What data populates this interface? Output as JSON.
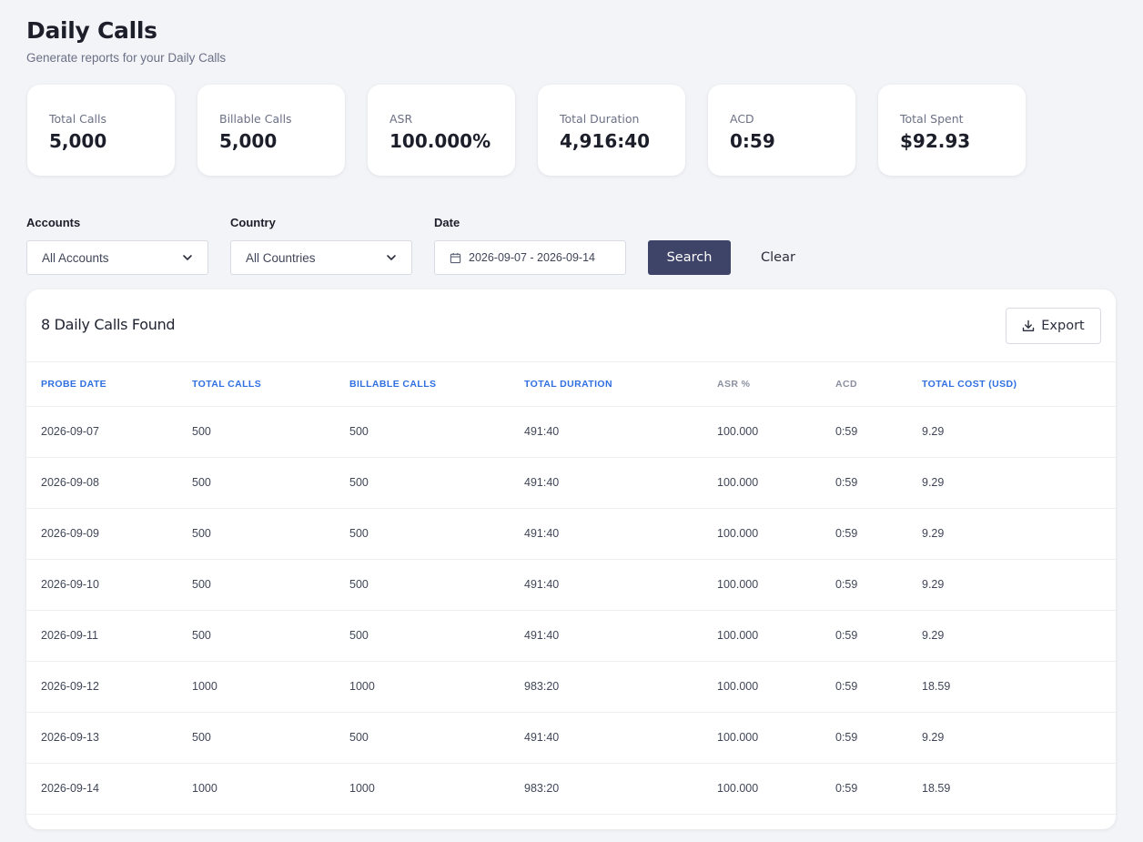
{
  "header": {
    "title": "Daily Calls",
    "subtitle": "Generate reports for your Daily Calls"
  },
  "stats": [
    {
      "label": "Total Calls",
      "value": "5,000"
    },
    {
      "label": "Billable Calls",
      "value": "5,000"
    },
    {
      "label": "ASR",
      "value": "100.000%"
    },
    {
      "label": "Total Duration",
      "value": "4,916:40"
    },
    {
      "label": "ACD",
      "value": "0:59"
    },
    {
      "label": "Total Spent",
      "value": "$92.93"
    }
  ],
  "filters": {
    "accounts_label": "Accounts",
    "accounts_value": "All Accounts",
    "country_label": "Country",
    "country_value": "All Countries",
    "date_label": "Date",
    "date_value": "2026-09-07 - 2026-09-14",
    "search_label": "Search",
    "clear_label": "Clear"
  },
  "table": {
    "found_text": "8 Daily Calls Found",
    "export_label": "Export",
    "columns": [
      "Probe Date",
      "Total Calls",
      "Billable Calls",
      "Total Duration",
      "ASR %",
      "ACD",
      "Total Cost (USD)"
    ],
    "rows": [
      [
        "2026-09-07",
        "500",
        "500",
        "491:40",
        "100.000",
        "0:59",
        "9.29"
      ],
      [
        "2026-09-08",
        "500",
        "500",
        "491:40",
        "100.000",
        "0:59",
        "9.29"
      ],
      [
        "2026-09-09",
        "500",
        "500",
        "491:40",
        "100.000",
        "0:59",
        "9.29"
      ],
      [
        "2026-09-10",
        "500",
        "500",
        "491:40",
        "100.000",
        "0:59",
        "9.29"
      ],
      [
        "2026-09-11",
        "500",
        "500",
        "491:40",
        "100.000",
        "0:59",
        "9.29"
      ],
      [
        "2026-09-12",
        "1000",
        "1000",
        "983:20",
        "100.000",
        "0:59",
        "18.59"
      ],
      [
        "2026-09-13",
        "500",
        "500",
        "491:40",
        "100.000",
        "0:59",
        "9.29"
      ],
      [
        "2026-09-14",
        "1000",
        "1000",
        "983:20",
        "100.000",
        "0:59",
        "18.59"
      ]
    ]
  },
  "colors": {
    "primary_button": "#3e4368",
    "sortable_header": "#2f6fe0",
    "muted_header": "#8b90a0"
  }
}
